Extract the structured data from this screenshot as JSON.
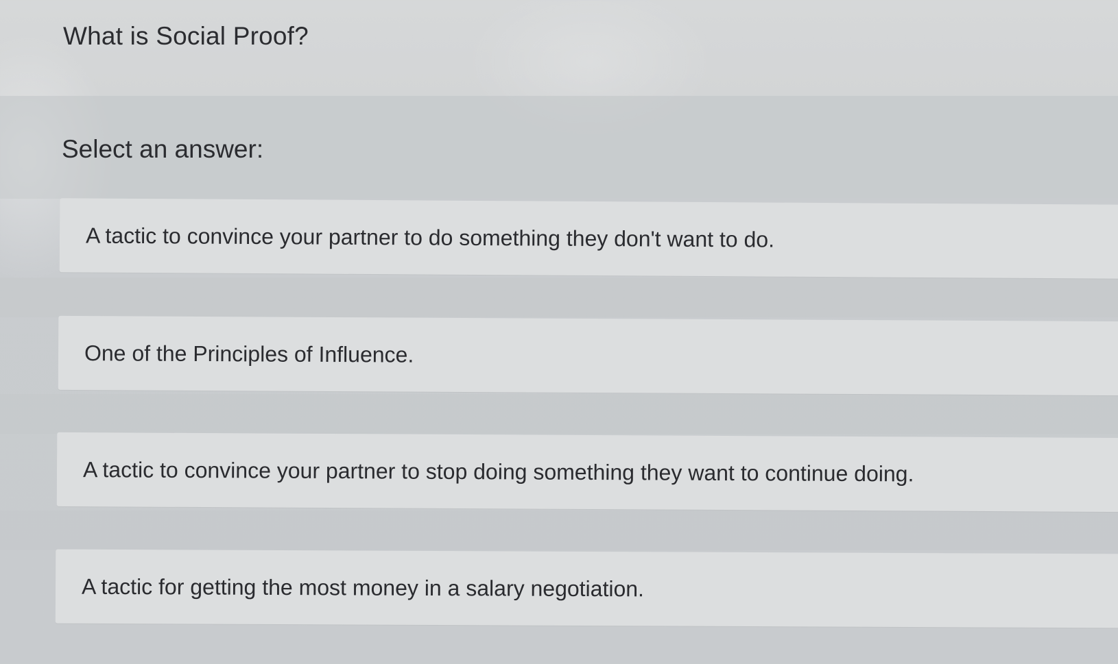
{
  "question": {
    "text": "What is Social Proof?"
  },
  "prompt": {
    "text": "Select an answer:"
  },
  "answers": [
    {
      "label": "A tactic to convince your partner to do something they don't want to do."
    },
    {
      "label": "One of the Principles of Influence."
    },
    {
      "label": "A tactic to convince your partner to stop doing something they want to continue doing."
    },
    {
      "label": "A tactic for getting the most money in a salary negotiation."
    }
  ],
  "colors": {
    "page_background": "#d3d5d6",
    "option_background": "#dcdedf",
    "text": "#2b2c30"
  }
}
